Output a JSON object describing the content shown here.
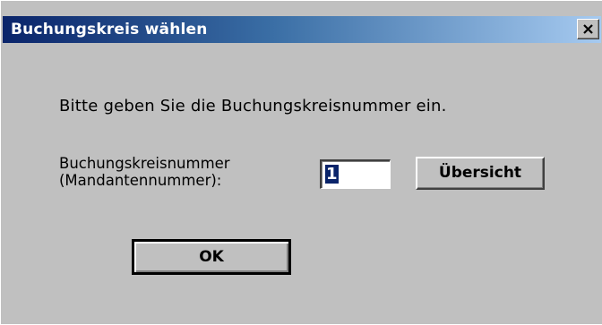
{
  "dialog": {
    "title": "Buchungskreis wählen",
    "close_symbol": "×",
    "prompt": "Bitte geben Sie die Buchungskreisnummer ein.",
    "field_label_line1": "Buchungskreisnummer",
    "field_label_line2": "(Mandantennummer):",
    "field_value": "1",
    "overview_button": "Übersicht",
    "ok_button": "OK"
  },
  "colors": {
    "face": "#c0c0c0",
    "title_start": "#0a246a",
    "title_end": "#a6caf0"
  },
  "icons": {
    "close": "close-icon"
  }
}
